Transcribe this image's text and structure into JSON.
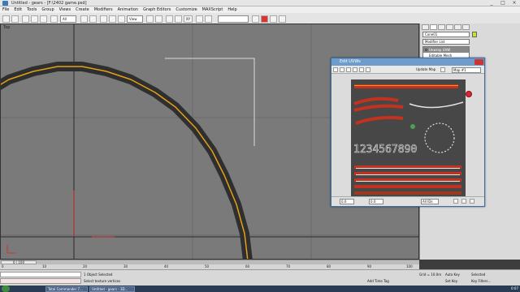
{
  "window": {
    "title": "Untitled - gears - [F:\\2402 game.psd]"
  },
  "menu": [
    "File",
    "Edit",
    "Tools",
    "Group",
    "Views",
    "Create",
    "Modifiers",
    "Animation",
    "Graph Editors",
    "Customize",
    "MAXScript",
    "Help"
  ],
  "toolbar": {
    "selection_filter": "All",
    "view_dropdown": "View",
    "axis_label": "XY"
  },
  "viewport": {
    "label": "Top"
  },
  "command_panel": {
    "object_name": "Cone01",
    "modifier_list": "Modifier List",
    "stack_items": [
      {
        "label": "Unwrap UVW",
        "selected": true
      },
      {
        "label": "Editable Mesh",
        "selected": false
      }
    ]
  },
  "uvw_editor": {
    "title": "Edit UVWs",
    "update_map": "Update Map",
    "map_dropdown": "Map #1",
    "uv_value": "0.0",
    "w_value": "0.0",
    "ids_dropdown": "All IDs",
    "canvas_digits": "1234567890"
  },
  "timeline": {
    "frame_display": "0 / 100",
    "ticks": [
      "0",
      "10",
      "20",
      "30",
      "40",
      "50",
      "60",
      "70",
      "80",
      "90",
      "100"
    ]
  },
  "status": {
    "line1": "1 Object Selected",
    "line2": "Select texture vertices",
    "grid": "Grid = 10.0m",
    "add_time_tag": "Add Time Tag",
    "auto_key": "Auto Key",
    "set_key": "Set Key",
    "key_filters": "Key Filters...",
    "selected": "Selected"
  },
  "taskbar": {
    "tasks": [
      "Total Commander 7...",
      "Untitled - gears - 3D..."
    ],
    "clock": "0:07"
  },
  "colors": {
    "ring_fill": "#2f2f2f",
    "ring_line": "#e3a019",
    "uv_red": "#c2321e"
  }
}
